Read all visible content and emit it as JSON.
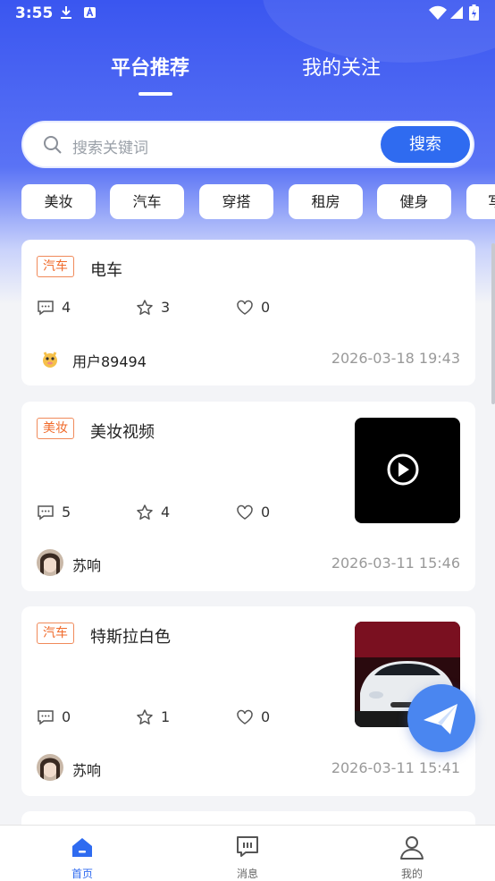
{
  "status_bar": {
    "time": "3:55"
  },
  "top_tabs": [
    {
      "label": "平台推荐",
      "active": true
    },
    {
      "label": "我的关注",
      "active": false
    }
  ],
  "search": {
    "placeholder": "搜索关键词",
    "button": "搜索"
  },
  "categories": [
    "美妆",
    "汽车",
    "穿搭",
    "租房",
    "健身",
    "写"
  ],
  "posts": [
    {
      "tag": "汽车",
      "title": "电车",
      "comments": "4",
      "stars": "3",
      "likes": "0",
      "user": "用户89494",
      "date": "2026-03-18 19:43",
      "thumbnail": "none"
    },
    {
      "tag": "美妆",
      "title": "美妆视频",
      "comments": "5",
      "stars": "4",
      "likes": "0",
      "user": "苏响",
      "date": "2026-03-11 15:46",
      "thumbnail": "video"
    },
    {
      "tag": "汽车",
      "title": "特斯拉白色",
      "comments": "0",
      "stars": "1",
      "likes": "0",
      "user": "苏响",
      "date": "2026-03-11 15:41",
      "thumbnail": "car-photo"
    }
  ],
  "bottom_nav": [
    {
      "label": "首页",
      "icon": "home-icon",
      "active": true
    },
    {
      "label": "消息",
      "icon": "message-icon",
      "active": false
    },
    {
      "label": "我的",
      "icon": "profile-icon",
      "active": false
    }
  ],
  "colors": {
    "primary": "#2f6bf0",
    "header": "#3a56f0",
    "tag": "#f06a2a",
    "fab": "#4a86f0"
  }
}
